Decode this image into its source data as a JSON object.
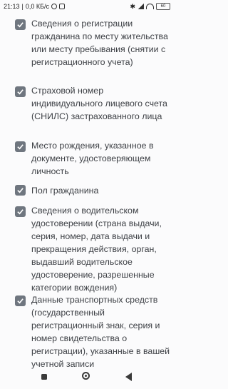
{
  "status_bar": {
    "time": "21:13",
    "speed": "0,0 КБ/с",
    "battery": "60"
  },
  "items": [
    {
      "label": "Сведения о регистрации гражданина по месту жительства или месту пребывания (снятии с регистрационного учета)",
      "checked": true
    },
    {
      "label": "Страховой номер индивидуального лицевого счета (СНИЛС) застрахованного лица",
      "checked": true
    },
    {
      "label": "Место рождения, указанное в документе, удостоверяющем личность",
      "checked": true
    },
    {
      "label": "Пол гражданина",
      "checked": true
    },
    {
      "label": "Сведения о водительском удостоверении (страна выдачи, серия, номер, дата выдачи и прекращения действия, орган, выдавший водительское удостоверение, разрешенные категории вождения)",
      "checked": true
    },
    {
      "label": "Данные транспортных средств (государственный регистрационный знак, серия и номер свидетельства о регистрации), указанные в вашей учетной записи",
      "checked": true
    }
  ],
  "colors": {
    "checkbox": "#6f767f",
    "text": "#3c3f44",
    "background": "#fbfbfc"
  }
}
